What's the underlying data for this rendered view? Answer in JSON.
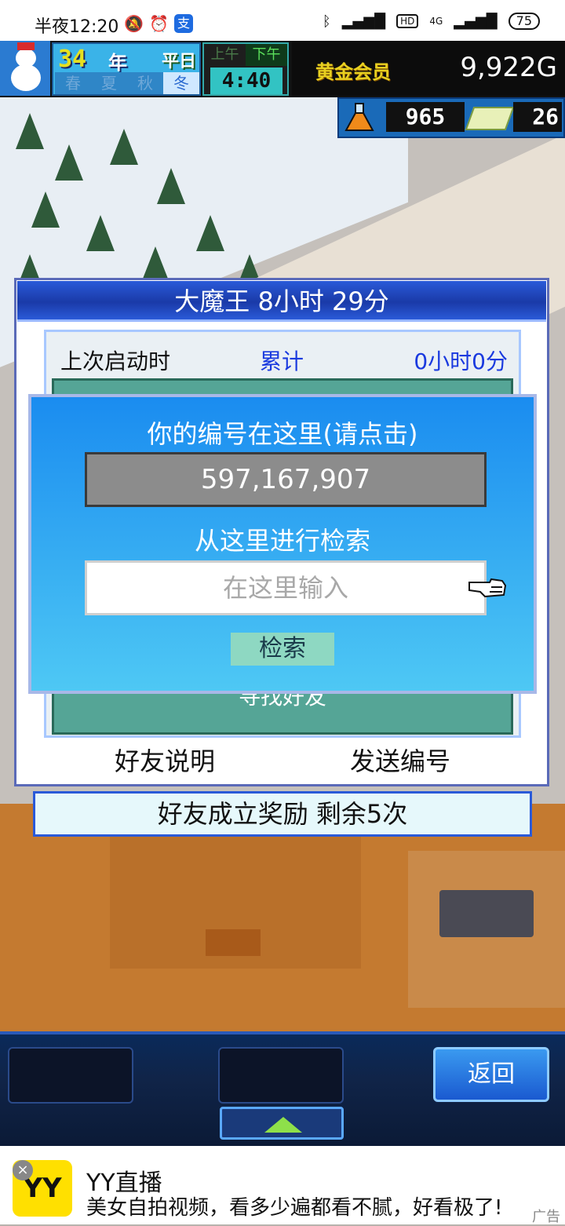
{
  "status_bar": {
    "time": "半夜12:20",
    "network": "4G",
    "hd": "HD",
    "battery": "75"
  },
  "hud": {
    "year": "34",
    "year_unit": "年",
    "difficulty": "平日",
    "seasons": [
      "春",
      "夏",
      "秋",
      "冬"
    ],
    "active_season": "冬",
    "am_label": "上午",
    "pm_label": "下午",
    "clock": "4:40",
    "member_label": "黄金会员",
    "gold": "9,922G",
    "research_points": "965",
    "tickets": "26"
  },
  "dialog": {
    "title": "大魔王  8小时 29分",
    "last_launch_label": "上次启动时",
    "total_label": "累计",
    "total_value": "0小时0分",
    "find_friend_label": "寻找好友",
    "friend_info_button": "好友说明",
    "send_id_button": "发送编号",
    "reward_text": "好友成立奖励  剩余5次"
  },
  "search_popup": {
    "title": "你的编号在这里(请点击)",
    "id_value": "597,167,907",
    "search_label": "从这里进行检索",
    "search_placeholder": "在这里输入",
    "search_button": "检索"
  },
  "bottom_bar": {
    "back_button": "返回"
  },
  "ad": {
    "logo_text": "YY",
    "title": "YY直播",
    "description": "美女自拍视频，看多少遍都看不腻，好看极了!",
    "tag": "广告"
  },
  "colors": {
    "dialog_title_bg": "#2a5ad8",
    "popup_bg_top": "#1a8cf0",
    "popup_bg_bottom": "#4ec8f4",
    "teal_panel": "#55a596",
    "search_button_bg": "#8ed8c2"
  }
}
